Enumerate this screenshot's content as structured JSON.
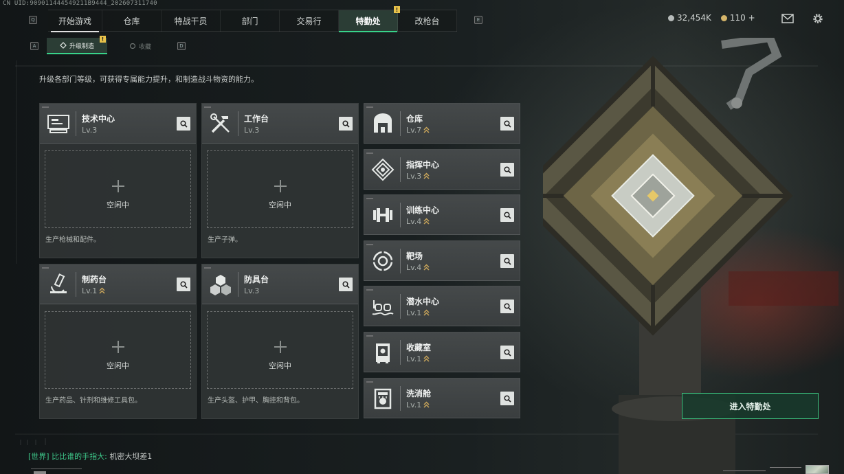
{
  "uid": "CN UID:909011444549211B9444_202607311740",
  "nav": {
    "tabs": [
      {
        "label": "开始游戏",
        "state": "current"
      },
      {
        "label": "仓库"
      },
      {
        "label": "特战干员"
      },
      {
        "label": "部门"
      },
      {
        "label": "交易行"
      },
      {
        "label": "特勤处",
        "state": "active",
        "badge": "!"
      },
      {
        "label": "改枪台"
      }
    ],
    "key_left": "Q",
    "key_right": "E"
  },
  "currency": {
    "silver": "32,454K",
    "gold": "110 +"
  },
  "subnav": {
    "key_left": "A",
    "key_right": "D",
    "tabs": [
      {
        "label": "升级制造",
        "active": true,
        "badge": "!"
      },
      {
        "label": "收藏"
      }
    ]
  },
  "description": "升级各部门等级，可获得专属能力提升，和制造战斗物资的能力。",
  "production": [
    {
      "name": "技术中心",
      "level": "Lv.3",
      "upgradable": false,
      "slot": "空闲中",
      "desc": "生产枪械和配件。",
      "icon": "terminal-icon"
    },
    {
      "name": "工作台",
      "level": "Lv.3",
      "upgradable": false,
      "slot": "空闲中",
      "desc": "生产子弹。",
      "icon": "tools-icon"
    },
    {
      "name": "制药台",
      "level": "Lv.1",
      "upgradable": true,
      "slot": "空闲中",
      "desc": "生产药品、针剂和维修工具包。",
      "icon": "microscope-icon"
    },
    {
      "name": "防具台",
      "level": "Lv.3",
      "upgradable": false,
      "slot": "空闲中",
      "desc": "生产头盔、护甲、胸挂和背包。",
      "icon": "boxes-icon"
    }
  ],
  "facilities": [
    {
      "name": "仓库",
      "level": "Lv.7",
      "icon": "warehouse-icon"
    },
    {
      "name": "指挥中心",
      "level": "Lv.3",
      "icon": "command-icon"
    },
    {
      "name": "训练中心",
      "level": "Lv.4",
      "icon": "dumbbell-icon"
    },
    {
      "name": "靶场",
      "level": "Lv.4",
      "icon": "target-icon"
    },
    {
      "name": "潜水中心",
      "level": "Lv.1",
      "icon": "goggles-icon"
    },
    {
      "name": "收藏室",
      "level": "Lv.1",
      "icon": "cabinet-icon"
    },
    {
      "name": "洗消舱",
      "level": "Lv.1",
      "icon": "shower-icon"
    }
  ],
  "enter_button": "进入特勤处",
  "chat": {
    "channel": "[世界]",
    "sender": "比比谁的手指大:",
    "message": "机密大坝差1"
  },
  "colors": {
    "accent": "#38d38a",
    "badge": "#e8c24a",
    "upgrade_arrow": "#c9a55a"
  }
}
